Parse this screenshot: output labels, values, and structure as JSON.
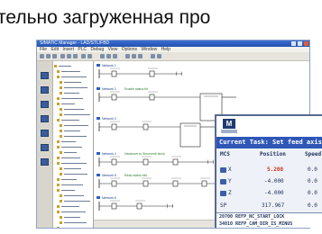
{
  "caption": "тельно загруженная про",
  "plc_window": {
    "title": "SIMATIC Manager - LAD/STL/FBD",
    "menu": [
      "File",
      "Edit",
      "Insert",
      "PLC",
      "Debug",
      "View",
      "Options",
      "Window",
      "Help"
    ]
  },
  "networks": [
    {
      "label": "Network 1",
      "comment": ""
    },
    {
      "label": "Network 2",
      "comment": "Enable status bit"
    },
    {
      "label": "Network 3",
      "comment": ""
    },
    {
      "label": "Network 4",
      "comment": "Handover to Sinumerik block"
    },
    {
      "label": "Network 5",
      "comment": "Read status bits"
    },
    {
      "label": "Network 6",
      "comment": ""
    }
  ],
  "hmi": {
    "logo_letter": "M",
    "task_line": "Current Task: Set feed axis rel",
    "columns": [
      "MCS",
      "Position",
      "Speed"
    ],
    "rows": [
      {
        "axis": "X",
        "position": "5.200",
        "speed": "0.0"
      },
      {
        "axis": "Y",
        "position": "-4.000",
        "speed": "0.0"
      },
      {
        "axis": "Z",
        "position": "-4.000",
        "speed": "0.0"
      },
      {
        "axis": "SP",
        "position": "317.967",
        "speed": "0.0"
      }
    ],
    "alarms": [
      "20700 REFP_NC_START_LOCK",
      "34010 REFP_CAM_DIR_IS_MINUS"
    ]
  }
}
